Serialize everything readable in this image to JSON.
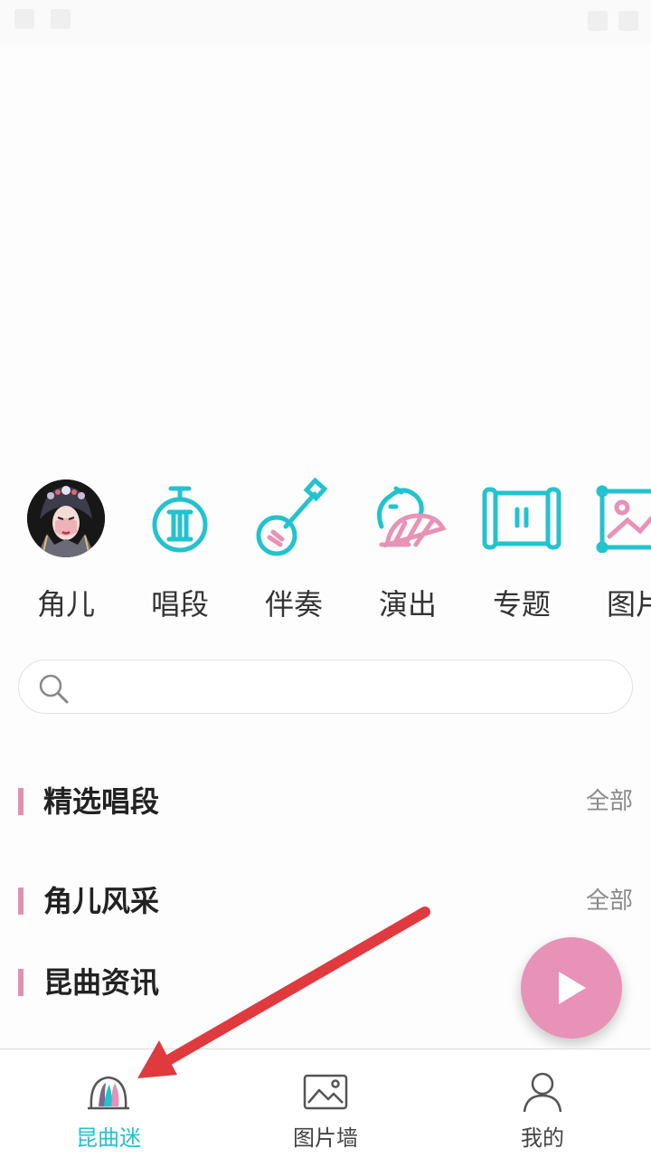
{
  "categories": [
    {
      "label": "角儿",
      "icon": "performer-avatar-icon"
    },
    {
      "label": "唱段",
      "icon": "lute-icon"
    },
    {
      "label": "伴奏",
      "icon": "sanxian-instrument-icon"
    },
    {
      "label": "演出",
      "icon": "opera-hat-fan-icon"
    },
    {
      "label": "专题",
      "icon": "scroll-icon"
    },
    {
      "label": "图片",
      "icon": "picture-frame-icon"
    }
  ],
  "search": {
    "placeholder": "",
    "value": ""
  },
  "sections": [
    {
      "title": "精选唱段",
      "more": "全部"
    },
    {
      "title": "角儿风采",
      "more": "全部"
    },
    {
      "title": "昆曲资讯",
      "more": ""
    }
  ],
  "nav": [
    {
      "label": "昆曲迷",
      "icon": "kunqu-logo-icon",
      "active": true
    },
    {
      "label": "图片墙",
      "icon": "image-icon",
      "active": false
    },
    {
      "label": "我的",
      "icon": "user-icon",
      "active": false
    }
  ],
  "colors": {
    "accent": "#22c3cf",
    "pink": "#e792b6",
    "section_bar": "#e38fb3",
    "annotation_arrow": "#e03a3e"
  }
}
